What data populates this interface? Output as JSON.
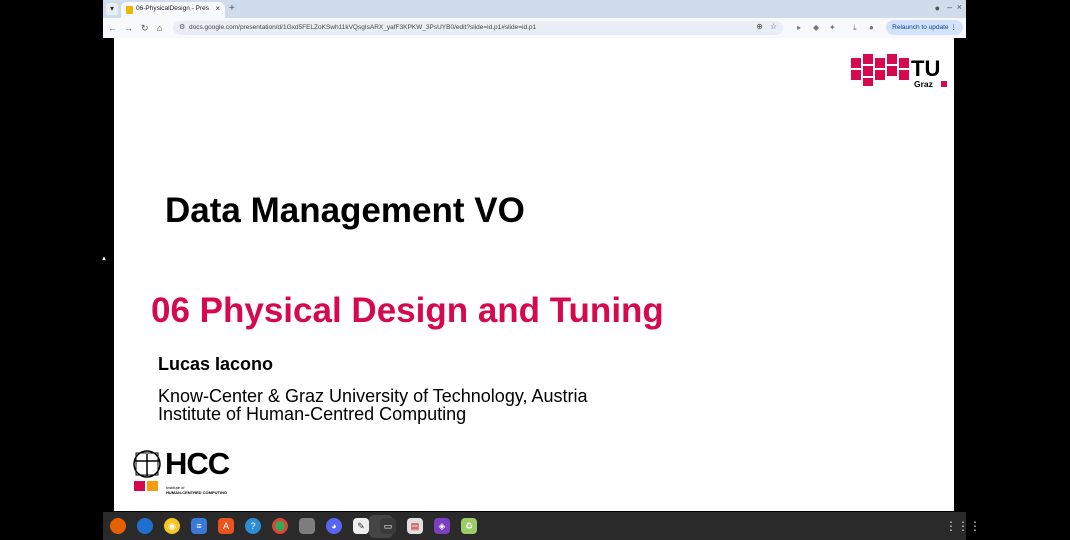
{
  "browser": {
    "tab_title": "06-PhysicalDesign - Pres",
    "url": "docs.google.com/presentation/d/1Gxd5FELZoKSwh11kVQsgIsARX_yafF3KPKW_3PsUYB0/edit?slide=id.p1#slide=id.p1",
    "relaunch_label": "Relaunch to update"
  },
  "slide": {
    "title": "Data Management VO",
    "subtitle": "06 Physical Design and Tuning",
    "author": "Lucas Iacono",
    "affiliation_line1": "Know-Center & Graz University of Technology, Austria",
    "affiliation_line2": "Institute of Human-Centred Computing",
    "tu_logo_text": "TU",
    "tu_logo_sub": "Graz",
    "hcc_text": "HCC",
    "hcc_sub_line1": "Institute of",
    "hcc_sub_line2": "HUMAN-CENTRED COMPUTING"
  },
  "colors": {
    "accent_red": "#d6094e",
    "taskbar": "#2a2a2a"
  },
  "taskbar": {
    "icons": [
      "firefox-icon",
      "thunderbird-icon",
      "rhythmbox-icon",
      "docs-icon",
      "app-center-icon",
      "help-icon",
      "chrome-icon",
      "files-icon",
      "discord-icon",
      "text-editor-icon",
      "terminal-icon",
      "document-viewer-icon",
      "tool-icon",
      "trash-icon"
    ]
  }
}
